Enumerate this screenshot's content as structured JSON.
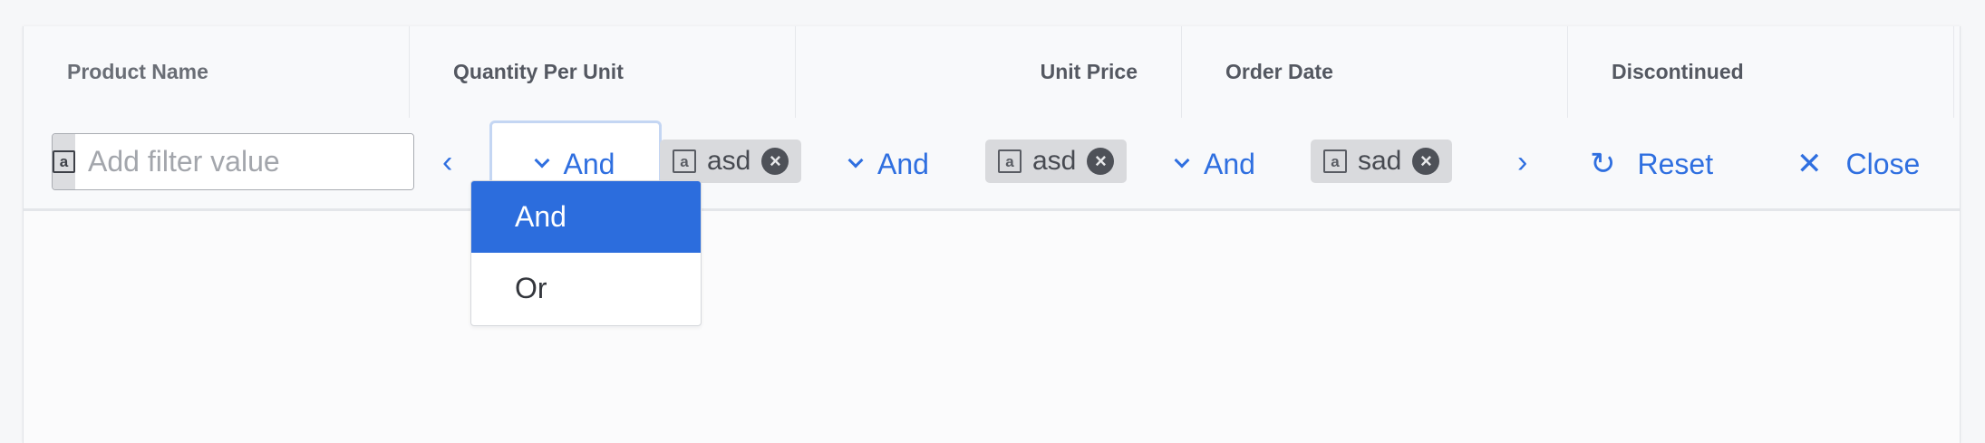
{
  "columns": [
    {
      "label": "Product Name",
      "align": "left"
    },
    {
      "label": "Quantity Per Unit",
      "align": "left"
    },
    {
      "label": "Unit Price",
      "align": "right"
    },
    {
      "label": "Order Date",
      "align": "left"
    },
    {
      "label": "Discontinued",
      "align": "left"
    }
  ],
  "filter": {
    "type_icon": "text-type-icon",
    "type_glyph": "a",
    "placeholder": "Add filter value",
    "value": "",
    "operators": [
      "And",
      "And",
      "And"
    ],
    "chips": [
      {
        "value": "asd"
      },
      {
        "value": "asd"
      },
      {
        "value": "sad"
      }
    ],
    "reset_label": "Reset",
    "close_label": "Close",
    "dropdown_options": [
      "And",
      "Or"
    ],
    "dropdown_selected": "And"
  },
  "colors": {
    "accent": "#2f6fe0",
    "selected_option_bg": "#2c6ddd"
  }
}
